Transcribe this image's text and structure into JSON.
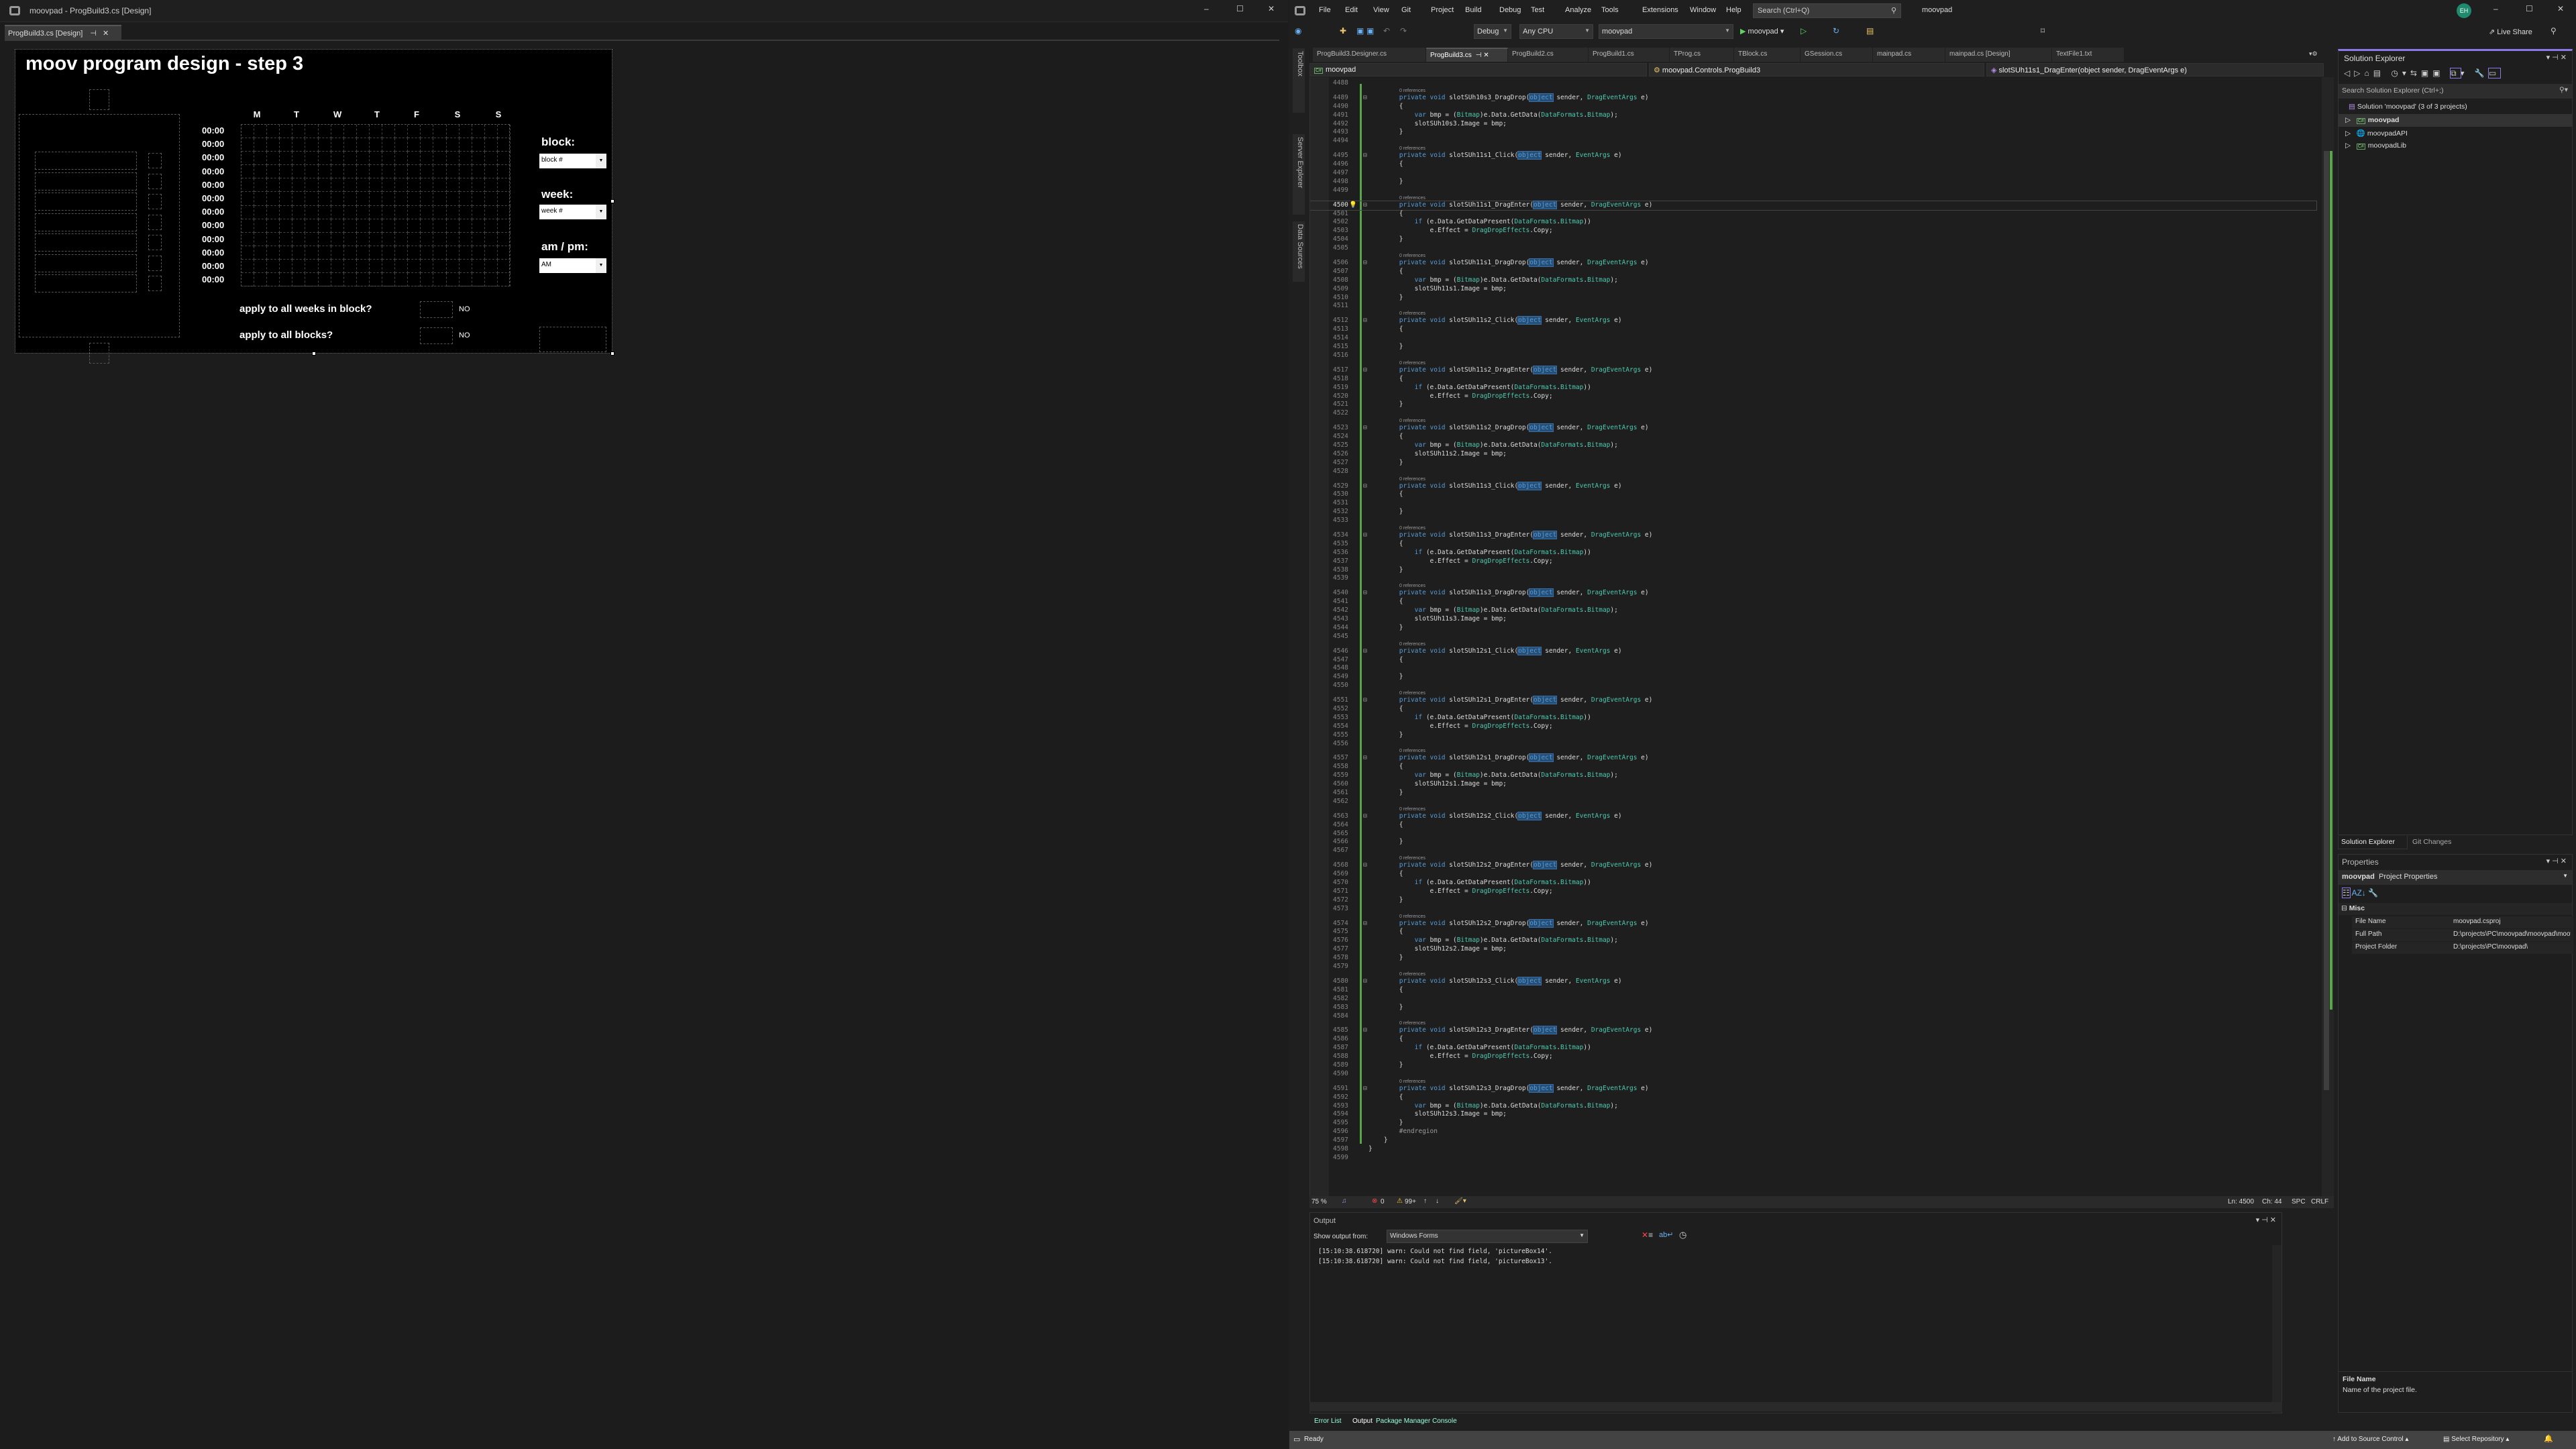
{
  "designer": {
    "window_title": "moovpad - ProgBuild3.cs [Design]",
    "tab_label": "ProgBuild3.cs [Design]",
    "form": {
      "title": "moov program design - step 3",
      "days": [
        "M",
        "T",
        "W",
        "T",
        "F",
        "S",
        "S"
      ],
      "times": [
        "00:00",
        "00:00",
        "00:00",
        "00:00",
        "00:00",
        "00:00",
        "00:00",
        "00:00",
        "00:00",
        "00:00",
        "00:00",
        "00:00"
      ],
      "block_label": "block:",
      "block_value": "block #",
      "week_label": "week:",
      "week_value": "week #",
      "ampm_label": "am / pm:",
      "ampm_value": "AM",
      "apply_weeks_label": "apply to all weeks in block?",
      "apply_weeks_value": "NO",
      "apply_blocks_label": "apply to all blocks?",
      "apply_blocks_value": "NO"
    }
  },
  "vs": {
    "menu": [
      "File",
      "Edit",
      "View",
      "Git",
      "Project",
      "Build",
      "Debug",
      "Test",
      "Analyze",
      "Tools",
      "Extensions",
      "Window",
      "Help"
    ],
    "search_placeholder": "Search (Ctrl+Q)",
    "solution_name": "moovpad",
    "avatar": "EH",
    "toolbar": {
      "config": "Debug",
      "platform": "Any CPU",
      "startup": "moovpad",
      "run_label": "moovpad",
      "live_share": "Live Share"
    },
    "side_tabs": [
      "Toolbox",
      "Server Explorer",
      "Data Sources"
    ],
    "doc_tabs": [
      "ProgBuild3.Designer.cs",
      "ProgBuild3.cs",
      "ProgBuild2.cs",
      "ProgBuild1.cs",
      "TProg.cs",
      "TBlock.cs",
      "GSession.cs",
      "mainpad.cs",
      "mainpad.cs [Design]",
      "TextFile1.txt"
    ],
    "active_tab": 1,
    "nav": {
      "project": "moovpad",
      "class": "moovpad.Controls.ProgBuild3",
      "member": "slotSUh11s1_DragEnter(object sender, DragEventArgs e)"
    },
    "current_line": 4500,
    "code": [
      {
        "n": 4488,
        "t": ""
      },
      {
        "lens": "0 references"
      },
      {
        "n": 4489,
        "t": "        private void slotSUh10s3_DragDrop(object sender, DragEventArgs e)"
      },
      {
        "n": 4490,
        "t": "        {"
      },
      {
        "n": 4491,
        "t": "            var bmp = (Bitmap)e.Data.GetData(DataFormats.Bitmap);"
      },
      {
        "n": 4492,
        "t": "            slotSUh10s3.Image = bmp;"
      },
      {
        "n": 4493,
        "t": "        }"
      },
      {
        "n": 4494,
        "t": ""
      },
      {
        "lens": "0 references"
      },
      {
        "n": 4495,
        "t": "        private void slotSUh11s1_Click(object sender, EventArgs e)"
      },
      {
        "n": 4496,
        "t": "        {"
      },
      {
        "n": 4497,
        "t": ""
      },
      {
        "n": 4498,
        "t": "        }"
      },
      {
        "n": 4499,
        "t": ""
      },
      {
        "lens": "0 references"
      },
      {
        "n": 4500,
        "t": "        private void slotSUh11s1_DragEnter(object sender, DragEventArgs e)"
      },
      {
        "n": 4501,
        "t": "        {"
      },
      {
        "n": 4502,
        "t": "            if (e.Data.GetDataPresent(DataFormats.Bitmap))"
      },
      {
        "n": 4503,
        "t": "                e.Effect = DragDropEffects.Copy;"
      },
      {
        "n": 4504,
        "t": "        }"
      },
      {
        "n": 4505,
        "t": ""
      },
      {
        "lens": "0 references"
      },
      {
        "n": 4506,
        "t": "        private void slotSUh11s1_DragDrop(object sender, DragEventArgs e)"
      },
      {
        "n": 4507,
        "t": "        {"
      },
      {
        "n": 4508,
        "t": "            var bmp = (Bitmap)e.Data.GetData(DataFormats.Bitmap);"
      },
      {
        "n": 4509,
        "t": "            slotSUh11s1.Image = bmp;"
      },
      {
        "n": 4510,
        "t": "        }"
      },
      {
        "n": 4511,
        "t": ""
      },
      {
        "lens": "0 references"
      },
      {
        "n": 4512,
        "t": "        private void slotSUh11s2_Click(object sender, EventArgs e)"
      },
      {
        "n": 4513,
        "t": "        {"
      },
      {
        "n": 4514,
        "t": ""
      },
      {
        "n": 4515,
        "t": "        }"
      },
      {
        "n": 4516,
        "t": ""
      },
      {
        "lens": "0 references"
      },
      {
        "n": 4517,
        "t": "        private void slotSUh11s2_DragEnter(object sender, DragEventArgs e)"
      },
      {
        "n": 4518,
        "t": "        {"
      },
      {
        "n": 4519,
        "t": "            if (e.Data.GetDataPresent(DataFormats.Bitmap))"
      },
      {
        "n": 4520,
        "t": "                e.Effect = DragDropEffects.Copy;"
      },
      {
        "n": 4521,
        "t": "        }"
      },
      {
        "n": 4522,
        "t": ""
      },
      {
        "lens": "0 references"
      },
      {
        "n": 4523,
        "t": "        private void slotSUh11s2_DragDrop(object sender, DragEventArgs e)"
      },
      {
        "n": 4524,
        "t": "        {"
      },
      {
        "n": 4525,
        "t": "            var bmp = (Bitmap)e.Data.GetData(DataFormats.Bitmap);"
      },
      {
        "n": 4526,
        "t": "            slotSUh11s2.Image = bmp;"
      },
      {
        "n": 4527,
        "t": "        }"
      },
      {
        "n": 4528,
        "t": ""
      },
      {
        "lens": "0 references"
      },
      {
        "n": 4529,
        "t": "        private void slotSUh11s3_Click(object sender, EventArgs e)"
      },
      {
        "n": 4530,
        "t": "        {"
      },
      {
        "n": 4531,
        "t": ""
      },
      {
        "n": 4532,
        "t": "        }"
      },
      {
        "n": 4533,
        "t": ""
      },
      {
        "lens": "0 references"
      },
      {
        "n": 4534,
        "t": "        private void slotSUh11s3_DragEnter(object sender, DragEventArgs e)"
      },
      {
        "n": 4535,
        "t": "        {"
      },
      {
        "n": 4536,
        "t": "            if (e.Data.GetDataPresent(DataFormats.Bitmap))"
      },
      {
        "n": 4537,
        "t": "                e.Effect = DragDropEffects.Copy;"
      },
      {
        "n": 4538,
        "t": "        }"
      },
      {
        "n": 4539,
        "t": ""
      },
      {
        "lens": "0 references"
      },
      {
        "n": 4540,
        "t": "        private void slotSUh11s3_DragDrop(object sender, DragEventArgs e)"
      },
      {
        "n": 4541,
        "t": "        {"
      },
      {
        "n": 4542,
        "t": "            var bmp = (Bitmap)e.Data.GetData(DataFormats.Bitmap);"
      },
      {
        "n": 4543,
        "t": "            slotSUh11s3.Image = bmp;"
      },
      {
        "n": 4544,
        "t": "        }"
      },
      {
        "n": 4545,
        "t": ""
      },
      {
        "lens": "0 references"
      },
      {
        "n": 4546,
        "t": "        private void slotSUh12s1_Click(object sender, EventArgs e)"
      },
      {
        "n": 4547,
        "t": "        {"
      },
      {
        "n": 4548,
        "t": ""
      },
      {
        "n": 4549,
        "t": "        }"
      },
      {
        "n": 4550,
        "t": ""
      },
      {
        "lens": "0 references"
      },
      {
        "n": 4551,
        "t": "        private void slotSUh12s1_DragEnter(object sender, DragEventArgs e)"
      },
      {
        "n": 4552,
        "t": "        {"
      },
      {
        "n": 4553,
        "t": "            if (e.Data.GetDataPresent(DataFormats.Bitmap))"
      },
      {
        "n": 4554,
        "t": "                e.Effect = DragDropEffects.Copy;"
      },
      {
        "n": 4555,
        "t": "        }"
      },
      {
        "n": 4556,
        "t": ""
      },
      {
        "lens": "0 references"
      },
      {
        "n": 4557,
        "t": "        private void slotSUh12s1_DragDrop(object sender, DragEventArgs e)"
      },
      {
        "n": 4558,
        "t": "        {"
      },
      {
        "n": 4559,
        "t": "            var bmp = (Bitmap)e.Data.GetData(DataFormats.Bitmap);"
      },
      {
        "n": 4560,
        "t": "            slotSUh12s1.Image = bmp;"
      },
      {
        "n": 4561,
        "t": "        }"
      },
      {
        "n": 4562,
        "t": ""
      },
      {
        "lens": "0 references"
      },
      {
        "n": 4563,
        "t": "        private void slotSUh12s2_Click(object sender, EventArgs e)"
      },
      {
        "n": 4564,
        "t": "        {"
      },
      {
        "n": 4565,
        "t": ""
      },
      {
        "n": 4566,
        "t": "        }"
      },
      {
        "n": 4567,
        "t": ""
      },
      {
        "lens": "0 references"
      },
      {
        "n": 4568,
        "t": "        private void slotSUh12s2_DragEnter(object sender, DragEventArgs e)"
      },
      {
        "n": 4569,
        "t": "        {"
      },
      {
        "n": 4570,
        "t": "            if (e.Data.GetDataPresent(DataFormats.Bitmap))"
      },
      {
        "n": 4571,
        "t": "                e.Effect = DragDropEffects.Copy;"
      },
      {
        "n": 4572,
        "t": "        }"
      },
      {
        "n": 4573,
        "t": ""
      },
      {
        "lens": "0 references"
      },
      {
        "n": 4574,
        "t": "        private void slotSUh12s2_DragDrop(object sender, DragEventArgs e)"
      },
      {
        "n": 4575,
        "t": "        {"
      },
      {
        "n": 4576,
        "t": "            var bmp = (Bitmap)e.Data.GetData(DataFormats.Bitmap);"
      },
      {
        "n": 4577,
        "t": "            slotSUh12s2.Image = bmp;"
      },
      {
        "n": 4578,
        "t": "        }"
      },
      {
        "n": 4579,
        "t": ""
      },
      {
        "lens": "0 references"
      },
      {
        "n": 4580,
        "t": "        private void slotSUh12s3_Click(object sender, EventArgs e)"
      },
      {
        "n": 4581,
        "t": "        {"
      },
      {
        "n": 4582,
        "t": ""
      },
      {
        "n": 4583,
        "t": "        }"
      },
      {
        "n": 4584,
        "t": ""
      },
      {
        "lens": "0 references"
      },
      {
        "n": 4585,
        "t": "        private void slotSUh12s3_DragEnter(object sender, DragEventArgs e)"
      },
      {
        "n": 4586,
        "t": "        {"
      },
      {
        "n": 4587,
        "t": "            if (e.Data.GetDataPresent(DataFormats.Bitmap))"
      },
      {
        "n": 4588,
        "t": "                e.Effect = DragDropEffects.Copy;"
      },
      {
        "n": 4589,
        "t": "        }"
      },
      {
        "n": 4590,
        "t": ""
      },
      {
        "lens": "0 references"
      },
      {
        "n": 4591,
        "t": "        private void slotSUh12s3_DragDrop(object sender, DragEventArgs e)"
      },
      {
        "n": 4592,
        "t": "        {"
      },
      {
        "n": 4593,
        "t": "            var bmp = (Bitmap)e.Data.GetData(DataFormats.Bitmap);"
      },
      {
        "n": 4594,
        "t": "            slotSUh12s3.Image = bmp;"
      },
      {
        "n": 4595,
        "t": "        }"
      },
      {
        "n": 4596,
        "t": "        #endregion"
      },
      {
        "n": 4597,
        "t": "    }"
      },
      {
        "n": 4598,
        "t": "}"
      },
      {
        "n": 4599,
        "t": ""
      }
    ],
    "editor_status": {
      "zoom": "75 %",
      "errors": "0",
      "warnings": "99+",
      "line": "Ln: 4500",
      "col": "Ch: 44",
      "spaces": "SPC",
      "eol": "CRLF"
    },
    "output": {
      "title": "Output",
      "show_from_label": "Show output from:",
      "source": "Windows Forms",
      "lines": [
        "[15:10:38.618720] warn: Could not find field, 'pictureBox14'.",
        "[15:10:38.618720] warn: Could not find field, 'pictureBox13'."
      ]
    },
    "bottom_tabs": [
      "Error List",
      "Output",
      "Package Manager Console"
    ],
    "status": {
      "ready": "Ready",
      "source_control": "Add to Source Control",
      "repository": "Select Repository"
    },
    "solution_explorer": {
      "title": "Solution Explorer",
      "search_placeholder": "Search Solution Explorer (Ctrl+;)",
      "solution": "Solution 'moovpad' (3 of 3 projects)",
      "projects": [
        "moovpad",
        "moovpadAPI",
        "moovpadLib"
      ],
      "tabs": [
        "Solution Explorer",
        "Git Changes"
      ]
    },
    "properties": {
      "title": "Properties",
      "object": "moovpad",
      "object_type": "Project Properties",
      "category": "Misc",
      "rows": [
        {
          "k": "File Name",
          "v": "moovpad.csproj"
        },
        {
          "k": "Full Path",
          "v": "D:\\projects\\PC\\moovpad\\moovpad\\moovpad.csproj"
        },
        {
          "k": "Project Folder",
          "v": "D:\\projects\\PC\\moovpad\\"
        }
      ],
      "desc_title": "File Name",
      "desc_text": "Name of the project file."
    },
    "colors": {
      "accent": "#8a7ae6",
      "keyword": "#569cd6",
      "type": "#4ec9b0",
      "changed": "#57a64a",
      "statusbar": "#434343"
    }
  }
}
